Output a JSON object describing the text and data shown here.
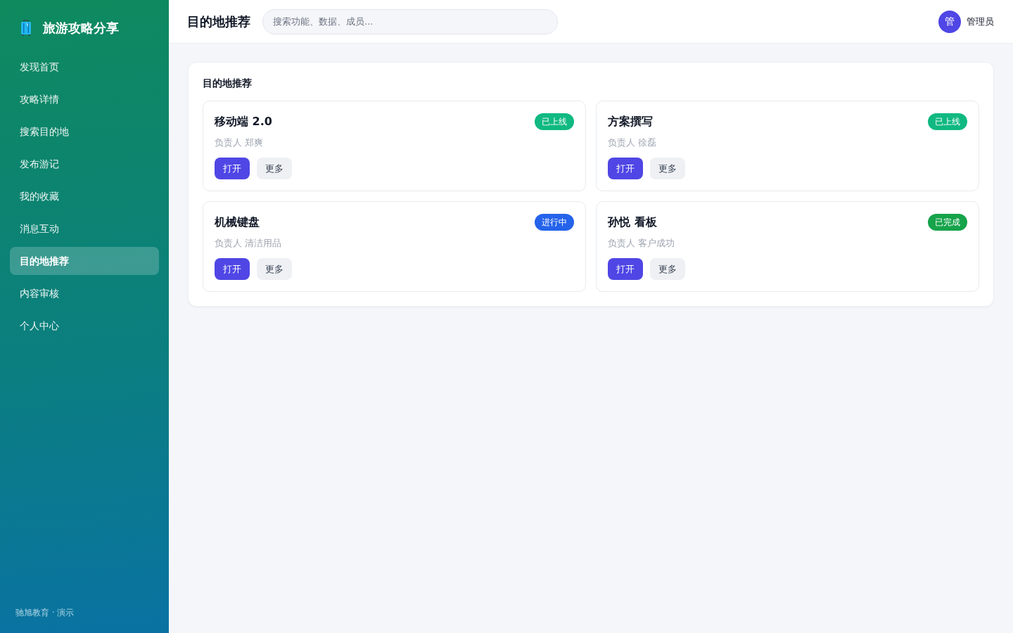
{
  "sidebar": {
    "brand": {
      "title": "旅游攻略分享"
    },
    "items": [
      {
        "label": "发现首页",
        "selected": false
      },
      {
        "label": "攻略详情",
        "selected": false
      },
      {
        "label": "搜索目的地",
        "selected": false
      },
      {
        "label": "发布游记",
        "selected": false
      },
      {
        "label": "我的收藏",
        "selected": false
      },
      {
        "label": "消息互动",
        "selected": false
      },
      {
        "label": "目的地推荐",
        "selected": true
      },
      {
        "label": "内容审核",
        "selected": false
      },
      {
        "label": "个人中心",
        "selected": false
      }
    ],
    "footer": "驰旭教育 · 演示"
  },
  "header": {
    "title": "目的地推荐",
    "search": {
      "placeholder": "搜索功能、数据、成员..."
    },
    "user": {
      "avatar": "管",
      "name": "管理员"
    }
  },
  "panel": {
    "title": "目的地推荐",
    "cards": [
      {
        "title": "移动端 2.0",
        "status": {
          "label": "已上线",
          "color": "#10b981"
        },
        "owner": "负责人 郑爽",
        "buttons": [
          {
            "label": "打开",
            "kind": "primary"
          },
          {
            "label": "更多",
            "kind": "secondary"
          }
        ]
      },
      {
        "title": "方案撰写",
        "status": {
          "label": "已上线",
          "color": "#10b981"
        },
        "owner": "负责人 徐磊",
        "buttons": [
          {
            "label": "打开",
            "kind": "primary"
          },
          {
            "label": "更多",
            "kind": "secondary"
          }
        ]
      },
      {
        "title": "机械键盘",
        "status": {
          "label": "进行中",
          "color": "#2563eb"
        },
        "owner": "负责人 清洁用品",
        "buttons": [
          {
            "label": "打开",
            "kind": "primary"
          },
          {
            "label": "更多",
            "kind": "secondary"
          }
        ]
      },
      {
        "title": "孙悦 看板",
        "status": {
          "label": "已完成",
          "color": "#16a34a"
        },
        "owner": "负责人 客户成功",
        "buttons": [
          {
            "label": "打开",
            "kind": "primary"
          },
          {
            "label": "更多",
            "kind": "secondary"
          }
        ]
      }
    ]
  }
}
